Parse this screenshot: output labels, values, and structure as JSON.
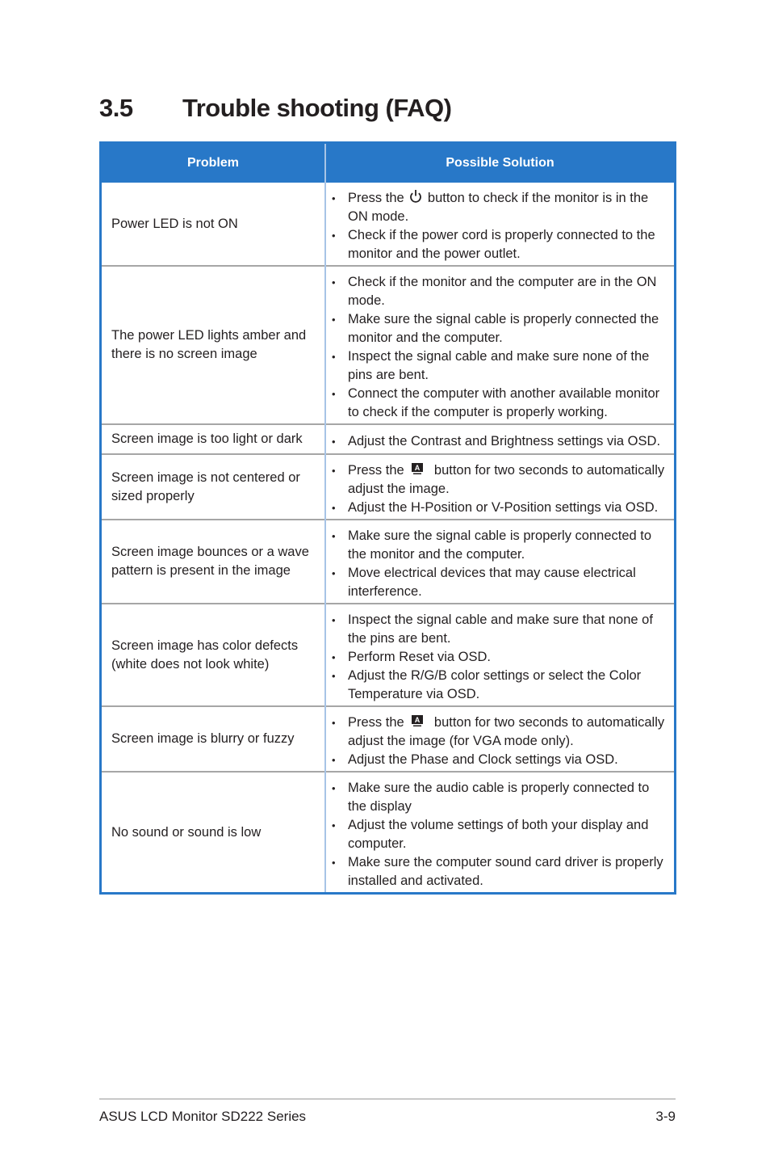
{
  "section": {
    "number": "3.5",
    "title": "Trouble shooting (FAQ)"
  },
  "table": {
    "headers": {
      "problem": "Problem",
      "solution": "Possible Solution"
    },
    "header_color": "#2878c8",
    "rows": [
      {
        "problem": "Power  LED is not ON",
        "solutions": [
          {
            "before": "Press the",
            "icon": "power-icon",
            "after": "button to check if the monitor is in the ON mode."
          },
          {
            "text": "Check if the power cord is properly connected to the monitor and the power outlet."
          }
        ]
      },
      {
        "problem": "The power LED lights amber and there is no screen image",
        "solutions": [
          {
            "text": "Check if the monitor and the computer are in the ON mode."
          },
          {
            "text": "Make sure the signal cable is properly connected the monitor and the computer."
          },
          {
            "text": "Inspect the signal cable and make sure none of the pins are bent."
          },
          {
            "text": "Connect the computer with another available monitor to check if the computer is properly working."
          }
        ]
      },
      {
        "problem": "Screen image is too light or dark",
        "solutions": [
          {
            "text": "Adjust the Contrast and Brightness settings via OSD."
          }
        ]
      },
      {
        "problem": "Screen image is not centered or sized properly",
        "solutions": [
          {
            "before": "Press the",
            "icon": "auto-adjust-icon",
            "after": "button for two seconds to automatically adjust the image."
          },
          {
            "text": "Adjust the H-Position or V-Position settings via OSD."
          }
        ]
      },
      {
        "problem": "Screen image bounces or a wave pattern is present in the image",
        "solutions": [
          {
            "text": "Make sure the signal cable is properly connected to the monitor and the computer."
          },
          {
            "text": "Move electrical devices that may cause electrical interference."
          }
        ]
      },
      {
        "problem": "Screen image has color defects (white does not look white)",
        "solutions": [
          {
            "text": "Inspect the signal cable and make sure that none of the pins are bent."
          },
          {
            "text": "Perform Reset via OSD."
          },
          {
            "text": "Adjust the R/G/B color settings or select the Color Temperature via OSD."
          }
        ]
      },
      {
        "problem": "Screen image is blurry or fuzzy",
        "solutions": [
          {
            "before": "Press the",
            "icon": "auto-adjust-icon",
            "after": "button for two seconds to automatically adjust the image (for VGA mode only)."
          },
          {
            "text": "Adjust the Phase and Clock settings via OSD."
          }
        ]
      },
      {
        "problem": "No sound or sound is low",
        "solutions": [
          {
            "text": " Make sure the audio cable is properly connected to the display"
          },
          {
            "text": "Adjust the volume settings of both your display and computer."
          },
          {
            "text": " Make sure the computer sound card driver is properly installed and activated."
          }
        ]
      }
    ]
  },
  "footer": {
    "product": "ASUS LCD Monitor SD222 Series",
    "page": "3-9"
  }
}
